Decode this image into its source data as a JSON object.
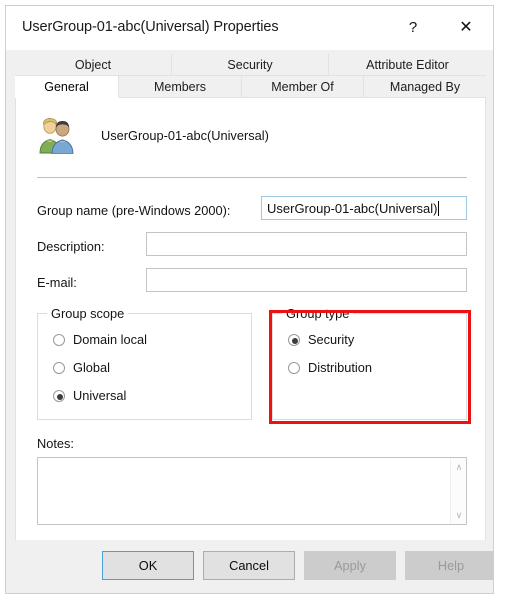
{
  "window": {
    "title": "UserGroup-01-abc(Universal) Properties",
    "help_glyph": "?",
    "close_glyph": "✕"
  },
  "tabs": {
    "row_top": [
      {
        "label": "Object",
        "selected": false
      },
      {
        "label": "Security",
        "selected": false
      },
      {
        "label": "Attribute Editor",
        "selected": false
      }
    ],
    "row_bottom": [
      {
        "label": "General",
        "selected": true
      },
      {
        "label": "Members",
        "selected": false
      },
      {
        "label": "Member Of",
        "selected": false
      },
      {
        "label": "Managed By",
        "selected": false
      }
    ]
  },
  "general": {
    "icon": "user-group-icon",
    "group_display_name": "UserGroup-01-abc(Universal)",
    "fields": {
      "group_name_label": "Group name (pre-Windows 2000):",
      "group_name_value": "UserGroup-01-abc(Universal)",
      "description_label": "Description:",
      "description_value": "",
      "email_label": "E-mail:",
      "email_value": ""
    },
    "group_scope": {
      "legend": "Group scope",
      "options": [
        {
          "label": "Domain local",
          "selected": false
        },
        {
          "label": "Global",
          "selected": false
        },
        {
          "label": "Universal",
          "selected": true
        }
      ]
    },
    "group_type": {
      "legend": "Group type",
      "highlighted": true,
      "highlight_color": "#ee1111",
      "options": [
        {
          "label": "Security",
          "selected": true
        },
        {
          "label": "Distribution",
          "selected": false
        }
      ]
    },
    "notes": {
      "label": "Notes:",
      "value": "",
      "scroll_up_glyph": "∧",
      "scroll_down_glyph": "∨"
    }
  },
  "footer": {
    "ok_label": "OK",
    "cancel_label": "Cancel",
    "apply_label": "Apply",
    "help_label": "Help"
  }
}
